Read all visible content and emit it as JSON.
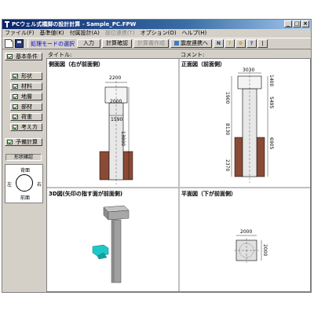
{
  "window": {
    "title": "PCウェル式橋脚の設計計算 - Sample_PC.FPW",
    "controls": [
      "_",
      "□",
      "×"
    ]
  },
  "menubar": {
    "items": [
      {
        "label": "ファイル(F)",
        "enabled": true
      },
      {
        "label": "基準値(K)",
        "enabled": true
      },
      {
        "label": "付属設計(A)",
        "enabled": true
      },
      {
        "label": "部位連携(T)",
        "enabled": false
      },
      {
        "label": "オプション(O)",
        "enabled": true
      },
      {
        "label": "ヘルプ(H)",
        "enabled": true
      }
    ]
  },
  "toolbar": {
    "mode_label": "処理モードの選択",
    "input_button": "入力",
    "calc_confirm_button": "計算確認",
    "calc_report_button": "計算書作成",
    "ground_link_button": "震度連携へ",
    "icons": [
      "new-file-icon",
      "save-icon",
      "unit-icon",
      "tip-icon",
      "key-icon",
      "info-icon",
      "exit-icon"
    ],
    "unit_label": "Unit",
    "tip_label": "?",
    "exit_label": "|"
  },
  "left_panel": {
    "top_button": "基本条件",
    "sub_buttons": [
      "形状",
      "材料",
      "地層",
      "部材",
      "荷重",
      "考え方"
    ],
    "precalc_button": "予備計算",
    "shape_confirm_label": "形状確認",
    "shape_labels": {
      "back": "背面",
      "left": "左",
      "right": "右",
      "front": "前面"
    }
  },
  "main": {
    "title_label": "タイトル:",
    "comment_label": "コメント:",
    "panes": {
      "side": {
        "title": "側面図（右が前面側）",
        "dims": {
          "top_width": "2200",
          "cap_height": "2000",
          "shaft_width": "1590",
          "total_height": "13800"
        }
      },
      "front": {
        "title": "正面図（前面側）",
        "dims": {
          "top_width": "3030",
          "cap_height": "1400",
          "upper": "1900",
          "col_height": "5495",
          "mid": "8130",
          "lower": "6905",
          "base": "2370"
        }
      },
      "view3d": {
        "title": "3D図(矢印の指す面が前面側)"
      },
      "plan": {
        "title": "平面図（下が前面側）",
        "dims": {
          "width": "2000",
          "depth": "2000"
        }
      }
    }
  },
  "colors": {
    "titlebar_start": "#0a246a",
    "titlebar_end": "#a6caf0",
    "mode_label": "#0000c8",
    "soil": "#8b4a35",
    "check": "#007800",
    "model_gray": "#a0a0a0",
    "arrow_cyan": "#1ec8c8"
  }
}
